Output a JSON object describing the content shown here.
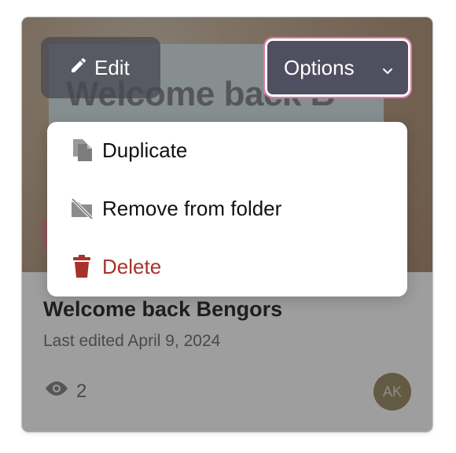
{
  "card": {
    "thumbnail_title": "Welcome back B",
    "title": "Welcome back Bengors",
    "last_edited": "Last edited April 9, 2024",
    "views": "2",
    "avatar_initials": "AK"
  },
  "toolbar": {
    "edit_label": "Edit",
    "options_label": "Options"
  },
  "menu": {
    "items": [
      {
        "label": "Duplicate",
        "icon": "duplicate-icon"
      },
      {
        "label": "Remove from folder",
        "icon": "folder-off-icon"
      },
      {
        "label": "Delete",
        "icon": "trash-icon"
      }
    ]
  },
  "colors": {
    "danger": "#a8322a",
    "focus_ring": "#e07aa6",
    "button_bg": "#4f4f60",
    "avatar_bg": "#a0926c"
  }
}
